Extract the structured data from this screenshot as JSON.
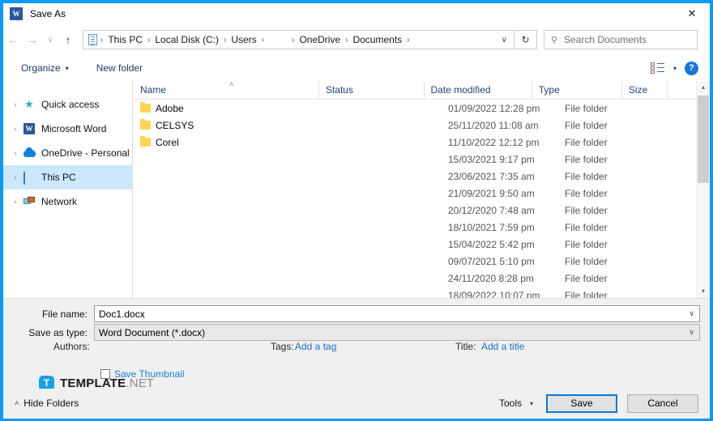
{
  "window": {
    "title": "Save As",
    "app_icon": "word-icon",
    "close_label": "✕",
    "accent_color": "#0a9bf5"
  },
  "nav": {
    "back_label": "←",
    "forward_label": "→",
    "recent_label": "∨",
    "up_label": "↑",
    "refresh_label": "↻",
    "address_chevron": "∨",
    "breadcrumbs": [
      {
        "label": "This PC"
      },
      {
        "label": "Local Disk (C:)"
      },
      {
        "label": "Users"
      },
      {
        "label": ""
      },
      {
        "label": "OneDrive"
      },
      {
        "label": "Documents"
      }
    ],
    "separator": "›"
  },
  "search": {
    "placeholder": "Search Documents",
    "icon": "search-icon"
  },
  "toolbar": {
    "organize_label": "Organize",
    "new_folder_label": "New folder",
    "caret": "▾",
    "view_icon": "list-view-icon",
    "view_caret": "▾",
    "help_label": "?"
  },
  "sidebar": {
    "items": [
      {
        "label": "Quick access",
        "icon": "star-icon",
        "expander": "›",
        "selected": false
      },
      {
        "label": "Microsoft Word",
        "icon": "word-icon",
        "expander": "›",
        "selected": false
      },
      {
        "label": "OneDrive - Personal",
        "icon": "cloud-icon",
        "expander": "›",
        "selected": false
      },
      {
        "label": "This PC",
        "icon": "pc-icon",
        "expander": "›",
        "selected": true
      },
      {
        "label": "Network",
        "icon": "network-icon",
        "expander": "›",
        "selected": false
      }
    ]
  },
  "filelist": {
    "columns": {
      "name": "Name",
      "status": "Status",
      "date_modified": "Date modified",
      "type": "Type",
      "size": "Size"
    },
    "sort_caret": "˄",
    "rows": [
      {
        "name": "Adobe",
        "status": "",
        "date": "01/09/2022 12:28 pm",
        "type": "File folder",
        "size": ""
      },
      {
        "name": "CELSYS",
        "status": "",
        "date": "25/11/2020 11:08 am",
        "type": "File folder",
        "size": ""
      },
      {
        "name": "Corel",
        "status": "",
        "date": "11/10/2022 12:12 pm",
        "type": "File folder",
        "size": ""
      },
      {
        "name": "",
        "status": "",
        "date": "15/03/2021 9:17 pm",
        "type": "File folder",
        "size": ""
      },
      {
        "name": "",
        "status": "",
        "date": "23/06/2021 7:35 am",
        "type": "File folder",
        "size": ""
      },
      {
        "name": "",
        "status": "",
        "date": "21/09/2021 9:50 am",
        "type": "File folder",
        "size": ""
      },
      {
        "name": "",
        "status": "",
        "date": "20/12/2020 7:48 am",
        "type": "File folder",
        "size": ""
      },
      {
        "name": "",
        "status": "",
        "date": "18/10/2021 7:59 pm",
        "type": "File folder",
        "size": ""
      },
      {
        "name": "",
        "status": "",
        "date": "15/04/2022 5:42 pm",
        "type": "File folder",
        "size": ""
      },
      {
        "name": "",
        "status": "",
        "date": "09/07/2021 5:10 pm",
        "type": "File folder",
        "size": ""
      },
      {
        "name": "",
        "status": "",
        "date": "24/11/2020 8:28 pm",
        "type": "File folder",
        "size": ""
      },
      {
        "name": "",
        "status": "",
        "date": "18/09/2022 10:07 pm",
        "type": "File folder",
        "size": ""
      }
    ],
    "scroll_up": "▴",
    "scroll_down": "▾"
  },
  "form": {
    "file_name_label": "File name:",
    "file_name_value": "Doc1.docx",
    "save_as_type_label": "Save as type:",
    "save_as_type_value": "Word Document (*.docx)",
    "chevron": "∨",
    "authors_label": "Authors:",
    "authors_value": "",
    "tags_label": "Tags:",
    "tags_link": "Add a tag",
    "title_label": "Title:",
    "title_link": "Add a title",
    "save_thumbnail_label": "Save Thumbnail",
    "save_thumbnail_checked": false
  },
  "watermark": {
    "logo_letter": "T",
    "name": "TEMPLATE",
    "suffix": ".NET"
  },
  "footer": {
    "hide_folders_label": "Hide Folders",
    "hide_folders_caret": "˄",
    "tools_label": "Tools",
    "tools_caret": "▾",
    "save_label": "Save",
    "cancel_label": "Cancel"
  }
}
